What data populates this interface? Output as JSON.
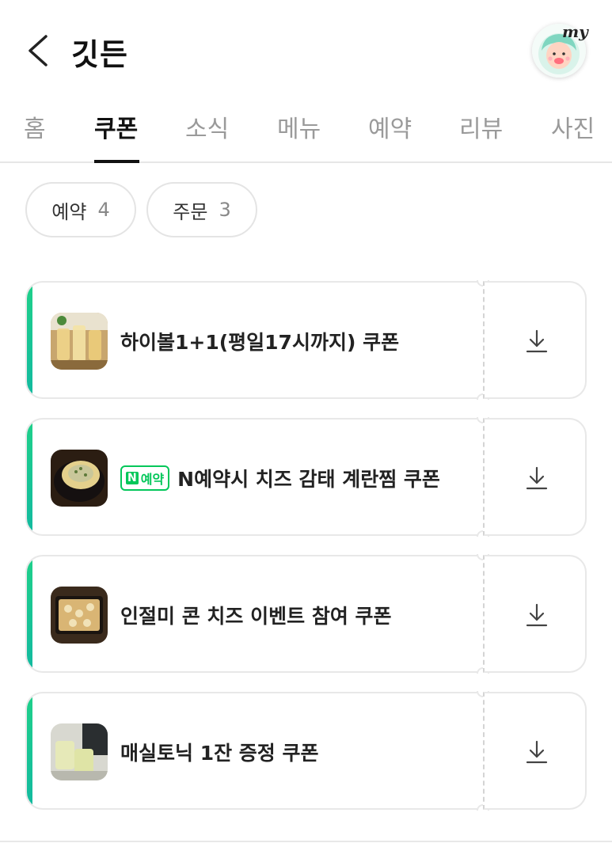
{
  "header": {
    "title": "깃든",
    "avatar_badge": "my"
  },
  "tabs": [
    {
      "label": "홈",
      "active": false
    },
    {
      "label": "쿠폰",
      "active": true
    },
    {
      "label": "소식",
      "active": false
    },
    {
      "label": "메뉴",
      "active": false
    },
    {
      "label": "예약",
      "active": false
    },
    {
      "label": "리뷰",
      "active": false
    },
    {
      "label": "사진",
      "active": false
    }
  ],
  "filters": [
    {
      "label": "예약",
      "count": "4"
    },
    {
      "label": "주문",
      "count": "3"
    }
  ],
  "coupons": [
    {
      "title": "하이볼1+1(평일17시까지) 쿠폰",
      "badge": null,
      "thumb_icon": "highball-drinks-photo"
    },
    {
      "title": "N예약시 치즈 감태 계란찜 쿠폰",
      "badge": "예약",
      "badge_mark": "N",
      "thumb_icon": "steamed-egg-photo"
    },
    {
      "title": "인절미 콘 치즈 이벤트 참여 쿠폰",
      "badge": null,
      "thumb_icon": "corn-cheese-photo"
    },
    {
      "title": "매실토닉 1잔 증정 쿠폰",
      "badge": null,
      "thumb_icon": "plum-tonic-photo"
    }
  ],
  "colors": {
    "accent_green": "#1fd08a",
    "naver_green": "#03c75a",
    "active_tab": "#111111",
    "inactive_tab": "#9a9a9a"
  }
}
